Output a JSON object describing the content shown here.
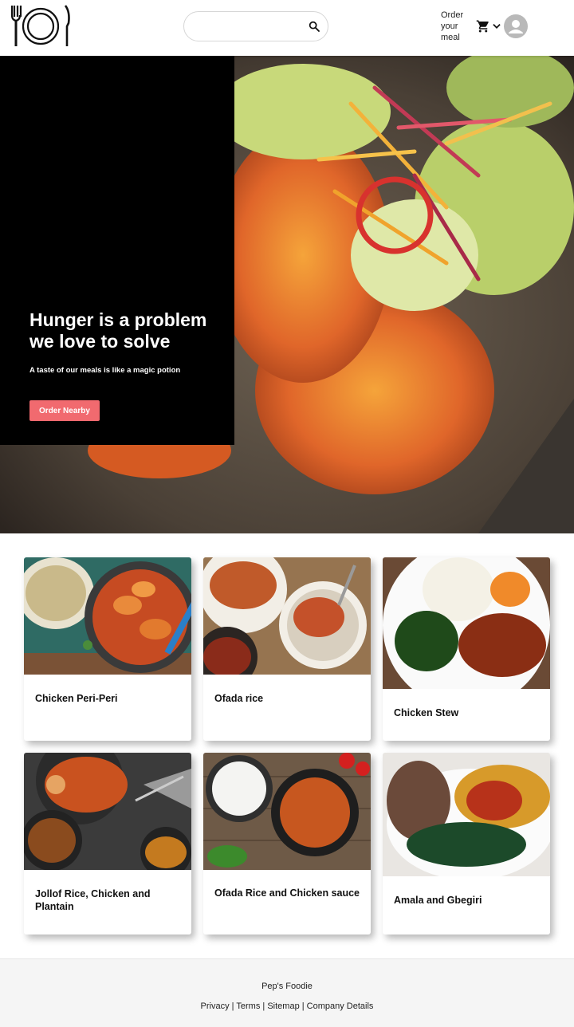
{
  "header": {
    "search_placeholder": "",
    "order_link": "Order your meal"
  },
  "hero": {
    "title": "Hunger is a problem we love to solve",
    "subtitle": "A taste of our meals is like a magic potion",
    "button": "Order Nearby"
  },
  "meals": [
    {
      "name": "Chicken Peri-Peri"
    },
    {
      "name": "Ofada rice"
    },
    {
      "name": "Chicken Stew"
    },
    {
      "name": "Jollof Rice, Chicken and Plantain"
    },
    {
      "name": "Ofada Rice and Chicken sauce"
    },
    {
      "name": "Amala and Gbegiri"
    }
  ],
  "footer": {
    "brand": "Pep's Foodie",
    "links": [
      "Privacy",
      "Terms",
      "Sitemap",
      "Company Details"
    ],
    "separator": " | "
  },
  "colors": {
    "accent": "#f16a6f",
    "hero_panel": "#000000"
  }
}
